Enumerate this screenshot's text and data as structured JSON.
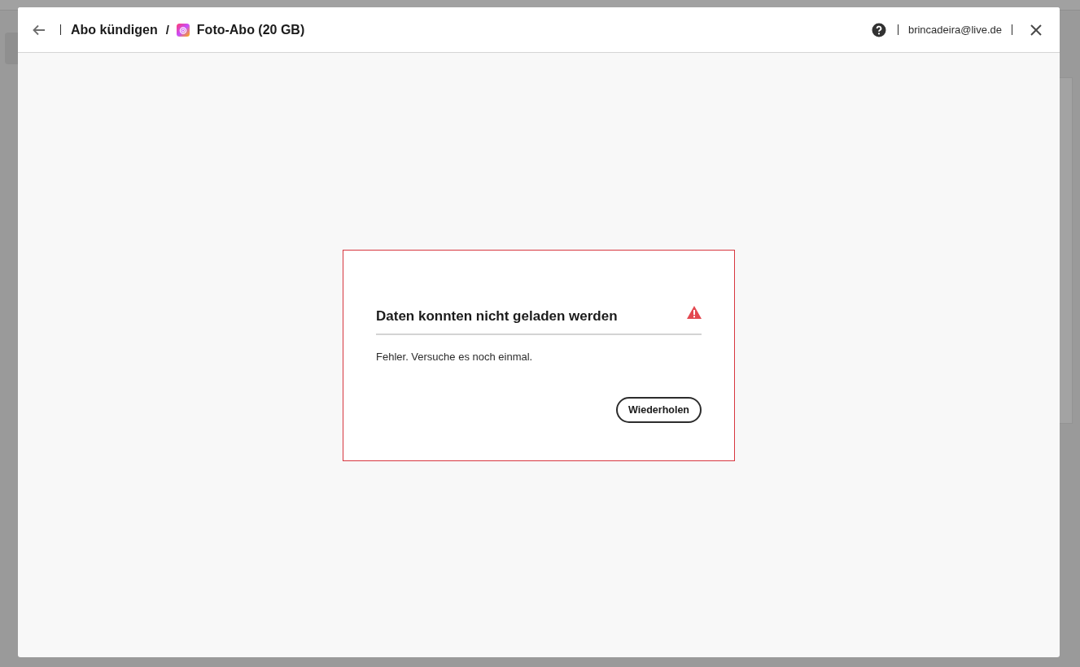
{
  "header": {
    "breadcrumb_separator": "/",
    "breadcrumb": [
      {
        "label": "Abo kündigen",
        "kind": "text"
      },
      {
        "label": "Foto-Abo (20 GB)",
        "kind": "app"
      }
    ],
    "account": "brincadeira@live.de"
  },
  "error": {
    "title": "Daten konnten nicht geladen werden",
    "message": "Fehler. Versuche es noch einmal.",
    "button": "Wiederholen"
  }
}
